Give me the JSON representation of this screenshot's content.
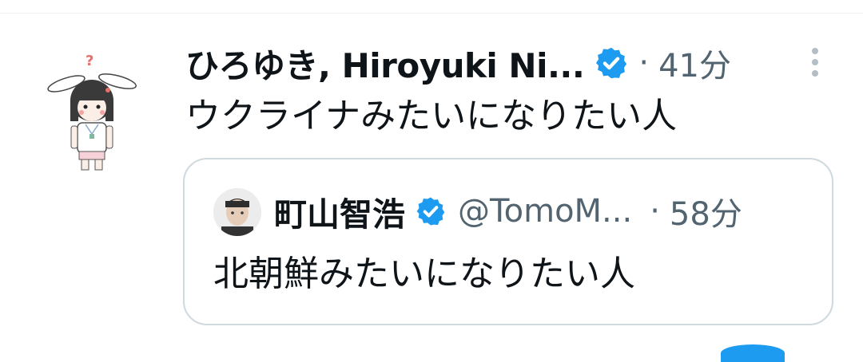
{
  "tweet": {
    "author_name": "ひろゆき, Hiroyuki Ni...",
    "separator": "·",
    "time": "41分",
    "text": "ウクライナみたいになりたい人",
    "more_icon": "more-vertical-icon",
    "verified_icon": "verified-badge-icon"
  },
  "quote": {
    "author_name": "町山智浩",
    "handle": "@TomoM...",
    "separator": "·",
    "time": "58分",
    "text": "北朝鮮みたいになりたい人",
    "verified_icon": "verified-badge-icon"
  },
  "colors": {
    "verified_blue": "#1d9bf0",
    "secondary_text": "#536471",
    "border": "#cfd9de"
  }
}
